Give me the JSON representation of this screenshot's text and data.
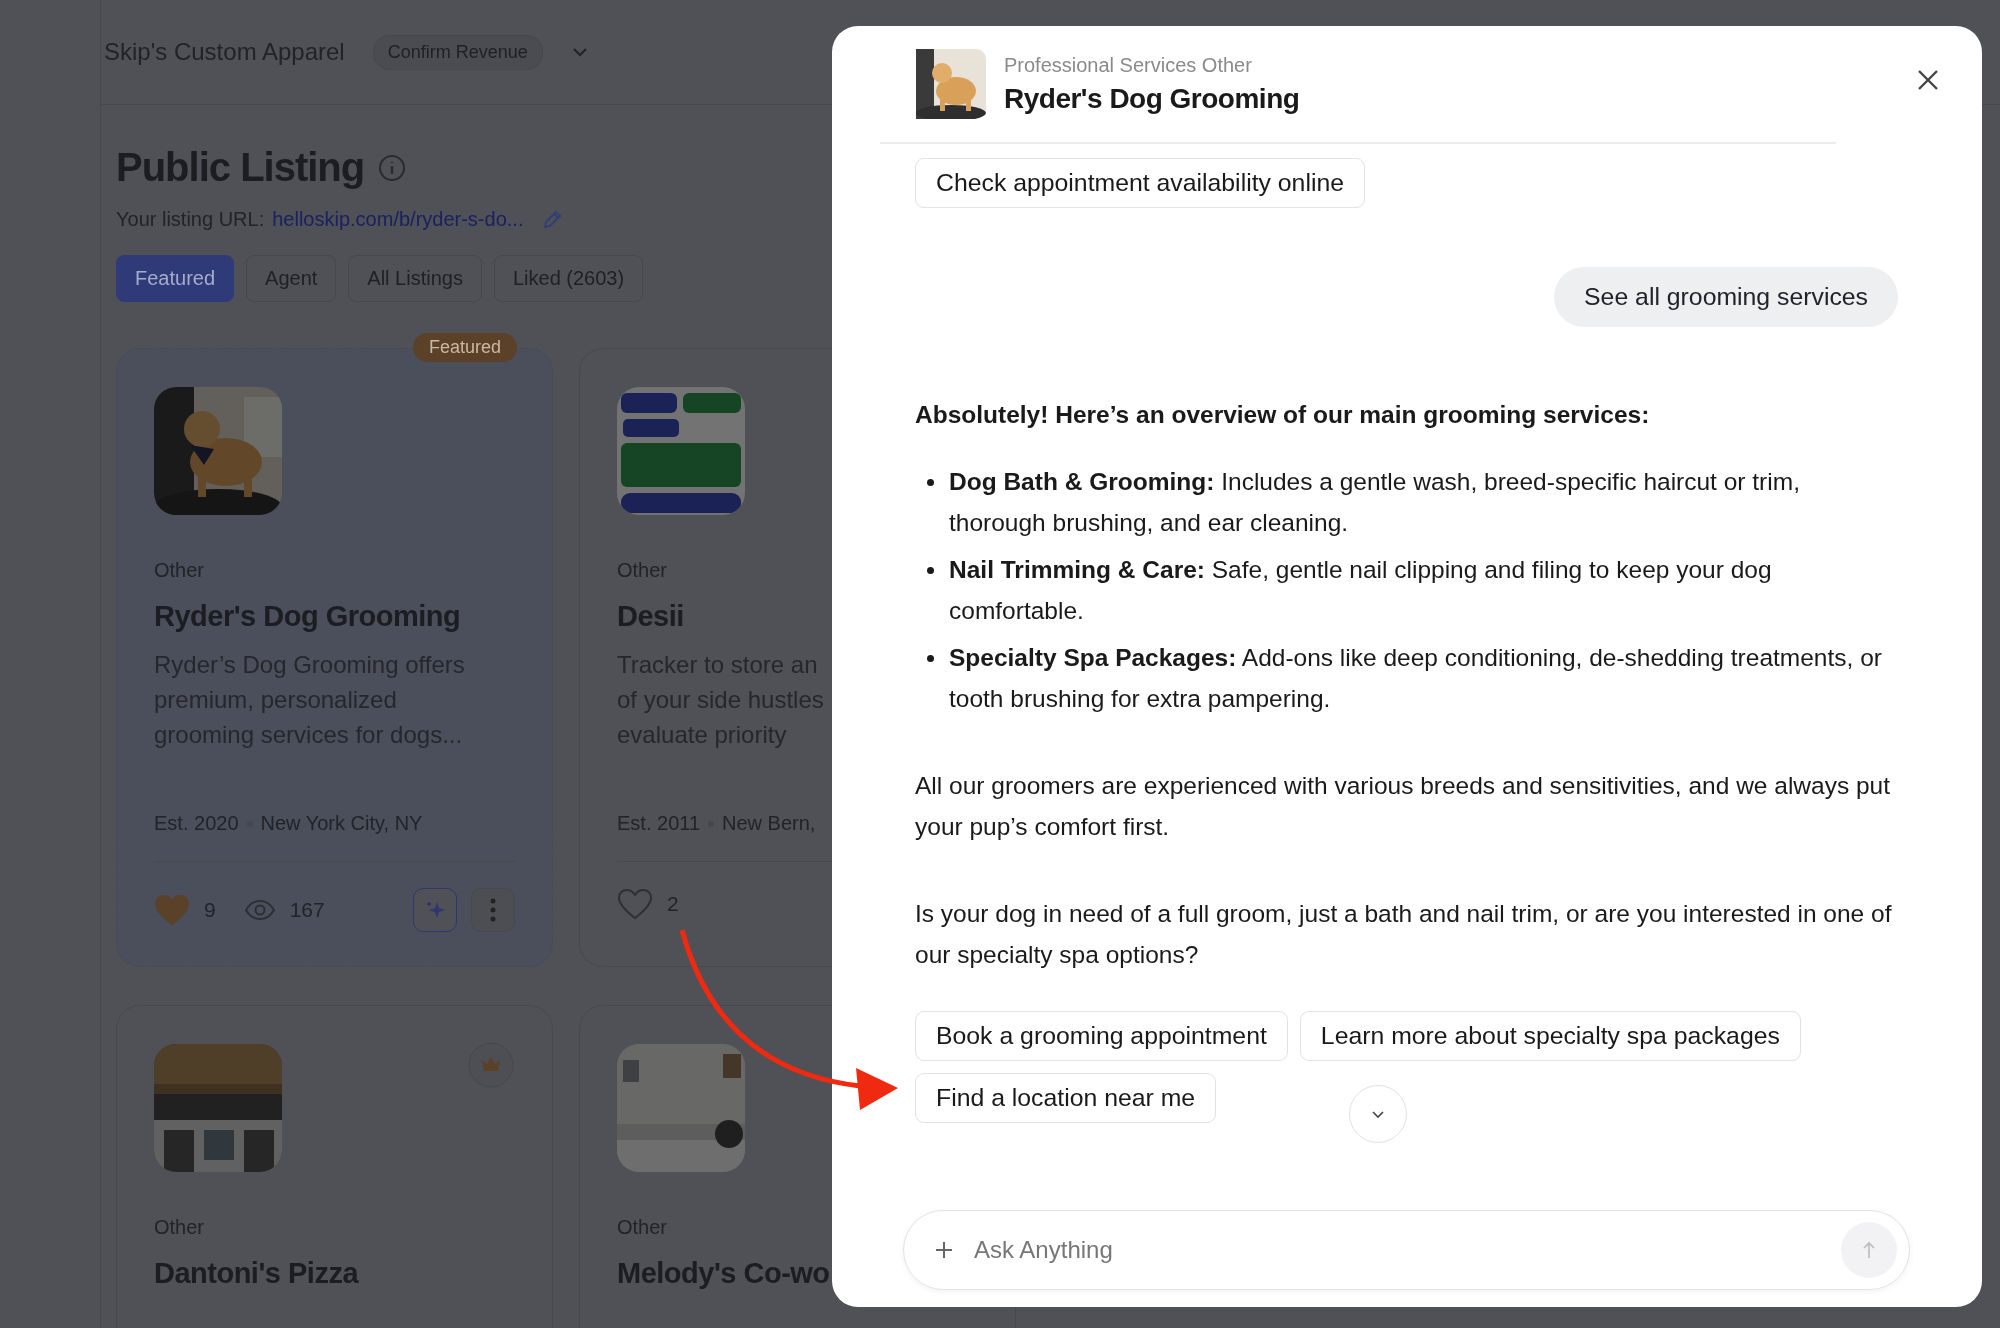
{
  "header": {
    "brand": "Skip's Custom Apparel",
    "action": "Confirm Revenue"
  },
  "listing": {
    "title": "Public Listing",
    "url_label": "Your listing URL:",
    "url": "helloskip.com/b/ryder-s-do..."
  },
  "tabs": [
    {
      "label": "Featured",
      "selected": true
    },
    {
      "label": "Agent",
      "selected": false
    },
    {
      "label": "All Listings",
      "selected": false
    },
    {
      "label": "Liked (2603)",
      "selected": false
    }
  ],
  "cards": [
    {
      "kind": "picture",
      "highlighted": true,
      "featured_label": "Featured",
      "crowned": false,
      "category": "Other",
      "title": "Ryder's Dog Grooming",
      "description": "Ryder’s Dog Grooming offers premium, personalized grooming services for dogs...",
      "est": "Est. 2020",
      "location": "New York City, NY",
      "liked": true,
      "likes": "9",
      "views": "167"
    },
    {
      "kind": "picture",
      "highlighted": false,
      "crowned": false,
      "category": "Other",
      "title": "Desii",
      "description_lines": [
        "Tracker to store an",
        "of your side hustles",
        "evaluate priority"
      ],
      "est": "Est. 2011",
      "location": "New Bern,",
      "liked": false,
      "likes": "2"
    },
    {
      "kind": "picture",
      "highlighted": false,
      "crowned": true,
      "category": "Other",
      "title": "Dantoni's Pizza"
    },
    {
      "kind": "picture",
      "highlighted": false,
      "crowned": false,
      "category": "Other",
      "title": "Melody's Co-wo"
    }
  ],
  "modal": {
    "category": "Professional Services Other",
    "title": "Ryder's Dog Grooming",
    "messages": [
      {
        "kind": "chips",
        "items": [
          "Check appointment availability online"
        ]
      },
      {
        "kind": "user",
        "text": "See all grooming services"
      },
      {
        "kind": "heading",
        "text": "Absolutely! Here’s an overview of our main grooming services:"
      },
      {
        "kind": "bullets",
        "items": [
          "**Dog Bath & Grooming:** Includes a gentle wash, breed-specific haircut or trim, thorough brushing, and ear cleaning.",
          "**Nail Trimming & Care:** Safe, gentle nail clipping and filing to keep your dog comfortable.",
          "**Specialty Spa Packages:** Add-ons like deep conditioning, de-shedding treatments, or tooth brushing for extra pampering."
        ]
      },
      {
        "kind": "paragraph",
        "text": "All our groomers are experienced with various breeds and sensitivities, and we always put your pup’s comfort first."
      },
      {
        "kind": "paragraph",
        "text": "Is your dog in need of a full groom, just a bath and nail trim, or are you interested in one of our specialty spa options?"
      },
      {
        "kind": "chips",
        "items": [
          "Book a grooming appointment",
          "Learn more about specialty spa packages",
          "Find a location near me"
        ]
      }
    ],
    "input": {
      "placeholder": "Ask Anything"
    }
  }
}
